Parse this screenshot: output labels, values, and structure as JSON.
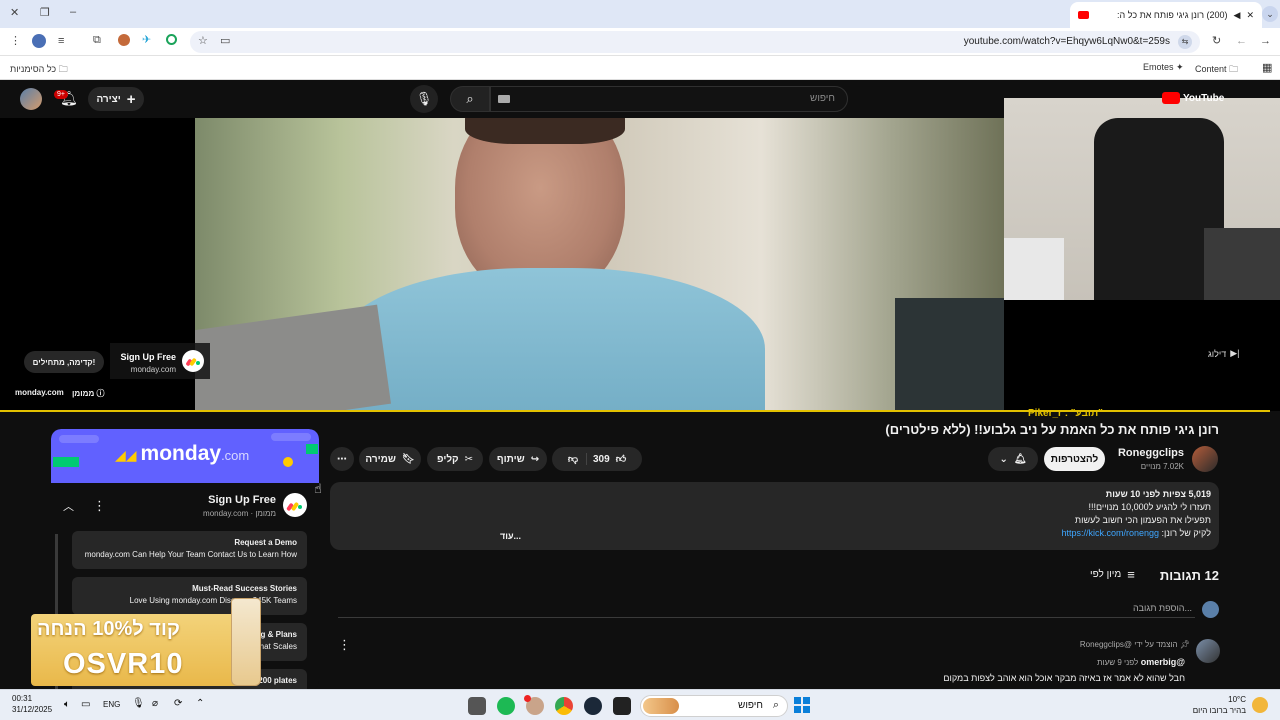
{
  "browser": {
    "tab_title": "(200) רונן גיגי פותח את כל ה:",
    "url": "youtube.com/watch?v=Ehqyw6LqNw0&t=259s",
    "bookmarks_right": [
      "כל הסימניות"
    ],
    "bookmarks_left": [
      "Content",
      "Emotes"
    ]
  },
  "yt": {
    "brand": "YouTube",
    "search_placeholder": "חיפוש",
    "create_label": "יצירה",
    "notif_count": "9+"
  },
  "ad": {
    "title": "Sign Up Free",
    "domain": "monday.com",
    "cta": "קדימה, מתחילים!",
    "sponsored": "ממומן",
    "bottom_domain": "monday.com",
    "skip": "דילוג",
    "banner_brand": "monday",
    "banner_suffix": ".com",
    "panel_title": "Sign Up Free",
    "panel_sub": "monday.com · ממומן",
    "items": [
      {
        "title": "Request a Demo",
        "text": "monday.com Can Help Your Team Contact Us to Learn How"
      },
      {
        "title": "Must-Read Success Stories",
        "text": "Love Using monday.com Discover 245K Teams"
      },
      {
        "title": "ing & Plans",
        "text": "hat Scales"
      },
      {
        "title": "+200 plates",
        "text": ""
      }
    ]
  },
  "promo": {
    "line1": "קוד ל10% הנחה",
    "line2": "OSVR10"
  },
  "video": {
    "overlay_text": "\"תובע\" : Piker_r",
    "title": "רונן גיגי פותח את כל האמת על ניב גלבוע!! (ללא פילטרים)",
    "channel": "Roneggclips",
    "subs": "7.02K מנויים",
    "subscribe": "להצטרפות",
    "likes": "309",
    "share": "שיתוף",
    "clip": "קליפ",
    "save": "שמירה"
  },
  "description": {
    "views": "5,019",
    "views_label": "צפיות",
    "time": "לפני 10 שעות",
    "line2": "תעזרו לי להגיע ל10,000 מנויים!!!",
    "line3": "תפעילו את הפעמון הכי חשוב לעשות",
    "link": "https://kick.com/ronengg",
    "link_prefix": "לקיק של רונן:",
    "more": "...עוד"
  },
  "comments": {
    "count_label": "12 תגובות",
    "sort_label": "מיון לפי",
    "add_placeholder": "הוספת תגובה...",
    "pinned_by": "הוצמד על ידי @Roneggclips",
    "author": "@omerbig",
    "age": "לפני 9 שעות",
    "text": "חבל שהוא לא אמר אז באיזה מבקר אוכל הוא אוהב לצפות במקום"
  },
  "taskbar": {
    "time": "00:31",
    "date": "31/12/2025",
    "lang": "ENG",
    "search": "חיפוש",
    "temp": "10°C",
    "weather": "בהיר ברובו היום"
  },
  "colors": {
    "accent_red": "#ff0000",
    "progress": "#e3c100",
    "monday_purple": "#6161ff"
  }
}
